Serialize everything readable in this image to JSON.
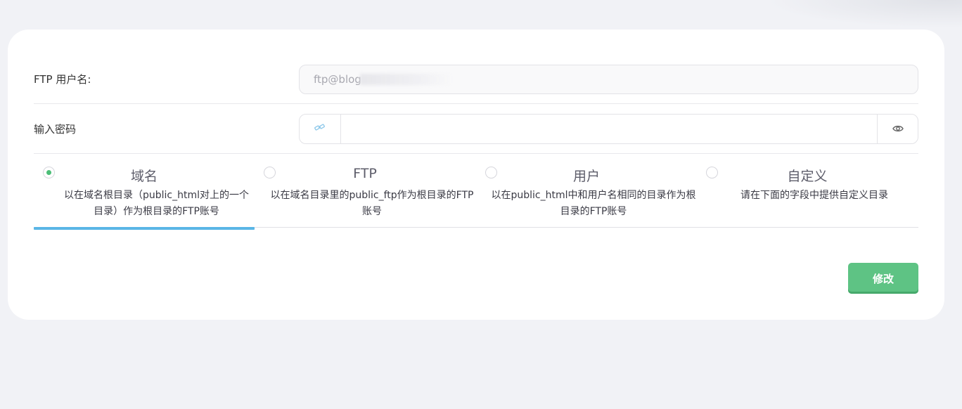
{
  "form": {
    "ftp_user": {
      "label": "FTP 用户名:",
      "value": "ftp@blog"
    },
    "password": {
      "label": "输入密码",
      "value": "",
      "generate_icon": "key-generate-icon",
      "toggle_icon": "eye-icon"
    }
  },
  "tabs": [
    {
      "title": "域名",
      "desc": "以在域名根目录（public_html对上的一个目录）作为根目录的FTP账号",
      "selected": true
    },
    {
      "title": "FTP",
      "desc": "以在域名目录里的public_ftp作为根目录的FTP账号",
      "selected": false
    },
    {
      "title": "用户",
      "desc": "以在public_html中和用户名相同的目录作为根目录的FTP账号",
      "selected": false
    },
    {
      "title": "自定义",
      "desc": "请在下面的字段中提供自定义目录",
      "selected": false
    }
  ],
  "actions": {
    "save_label": "修改"
  },
  "colors": {
    "accent_green": "#5ec384",
    "tab_indicator": "#5ab6e6",
    "radio_checked": "#4cbe77"
  }
}
